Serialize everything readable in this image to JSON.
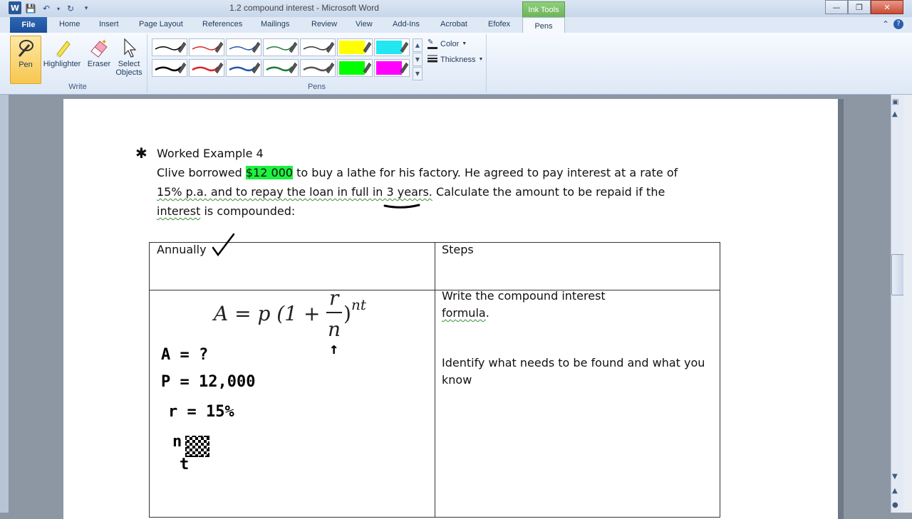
{
  "window": {
    "title": "1.2 compound interest - Microsoft Word",
    "contextual_tab_header": "Ink Tools",
    "app_icon_letter": "W"
  },
  "tabs": [
    {
      "label": "File"
    },
    {
      "label": "Home"
    },
    {
      "label": "Insert"
    },
    {
      "label": "Page Layout"
    },
    {
      "label": "References"
    },
    {
      "label": "Mailings"
    },
    {
      "label": "Review"
    },
    {
      "label": "View"
    },
    {
      "label": "Add-Ins"
    },
    {
      "label": "Acrobat"
    },
    {
      "label": "Efofex"
    },
    {
      "label": "Pens"
    }
  ],
  "ribbon": {
    "write_group": {
      "label": "Write",
      "pen": "Pen",
      "highlighter": "Highlighter",
      "eraser": "Eraser",
      "select_objects_line1": "Select",
      "select_objects_line2": "Objects"
    },
    "pens_group": {
      "label": "Pens",
      "color": "Color",
      "thickness": "Thickness",
      "swatches": [
        {
          "color": "#000000",
          "width": 1
        },
        {
          "color": "#d9252a",
          "width": 1
        },
        {
          "color": "#2456a8",
          "width": 1
        },
        {
          "color": "#1e7a3c",
          "width": 1
        },
        {
          "color": "#333333",
          "width": 1
        },
        {
          "color": "#ffff00",
          "width": 8
        },
        {
          "color": "#22e6f0",
          "width": 8
        },
        {
          "color": "#000000",
          "width": 2
        },
        {
          "color": "#d9252a",
          "width": 2
        },
        {
          "color": "#2456a8",
          "width": 2
        },
        {
          "color": "#1e7a3c",
          "width": 2
        },
        {
          "color": "#555555",
          "width": 2
        },
        {
          "color": "#00ff00",
          "width": 8
        },
        {
          "color": "#ff00ff",
          "width": 8
        }
      ]
    }
  },
  "document": {
    "heading": "Worked Example 4",
    "para": {
      "p1": "Clive borrowed ",
      "amount": "$12 000",
      "p2": " to buy a lathe for his factory. He agreed to pay interest at a rate of",
      "line2": "15% p.a. and to repay the loan in full in 3 years.",
      "line2b": " Calculate the amount to be repaid if the",
      "line3a": "interest",
      "line3b": " is compounded:"
    },
    "table": {
      "col1_header": "Annually",
      "col2_header": "Steps",
      "step1_line1": "Write the compound interest",
      "step1_line2": "formula",
      "step1_period": ".",
      "step2_line1": "Identify what needs to be found and what you",
      "step2_line2": "know"
    },
    "formula": {
      "lhs": "A = p (1 + ",
      "num": "r",
      "den": "n",
      "close": ")",
      "exp": "nt"
    },
    "handwriting": {
      "l1": "A = ?",
      "l2": "P = 12,000",
      "l3": "r = 15%",
      "l4": "n",
      "l5": "t",
      "arrow": "↑"
    }
  }
}
